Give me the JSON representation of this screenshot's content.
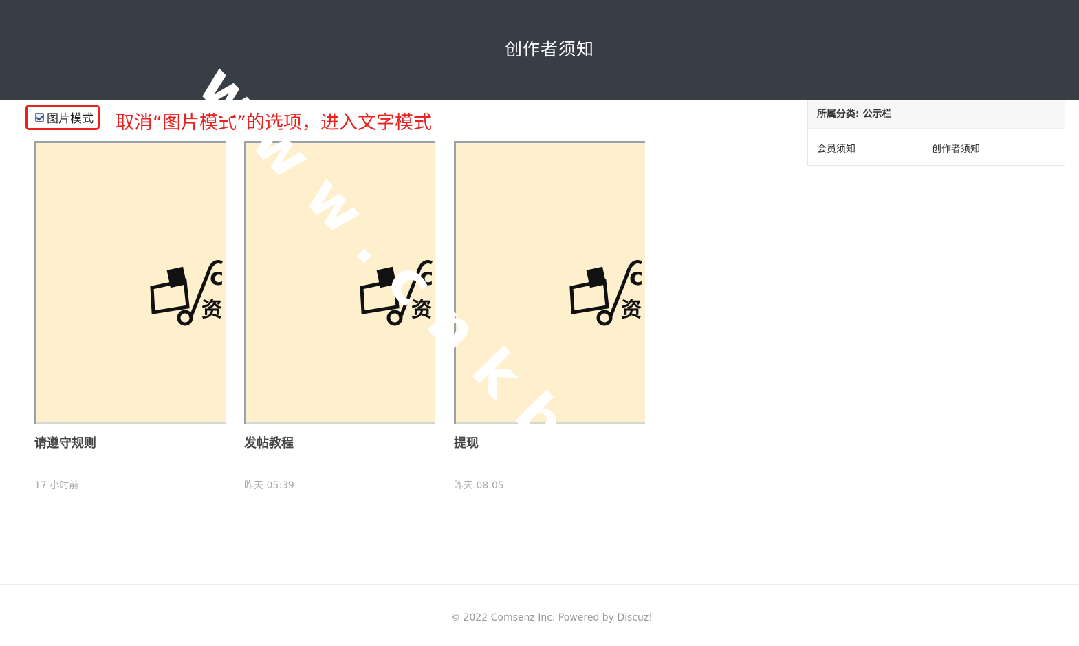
{
  "header": {
    "title": "创作者须知"
  },
  "toolbar": {
    "mode_label": "图片模式",
    "mode_checked": true,
    "hint_text": "取消“图片模式”的选项，进入文字模式"
  },
  "cards": [
    {
      "title": "请遵守规则",
      "time": "17 小时前",
      "thumb_text_1": "cr",
      "thumb_text_2": "资"
    },
    {
      "title": "发帖教程",
      "time": "昨天 05:39",
      "thumb_text_1": "cr",
      "thumb_text_2": "资"
    },
    {
      "title": "提现",
      "time": "昨天 08:05",
      "thumb_text_1": "cr",
      "thumb_text_2": "资"
    }
  ],
  "sidebar": {
    "heading": "所属分类: 公示栏",
    "links": [
      "会员须知",
      "创作者须知"
    ]
  },
  "footer": {
    "text": "© 2022 Comsenz Inc. Powered by Discuz!"
  },
  "watermark": {
    "text": "www.cnkbt"
  },
  "colors": {
    "header_bg": "#383e46",
    "accent_red": "#e8231f",
    "thumb_bg": "#fff0cd"
  }
}
